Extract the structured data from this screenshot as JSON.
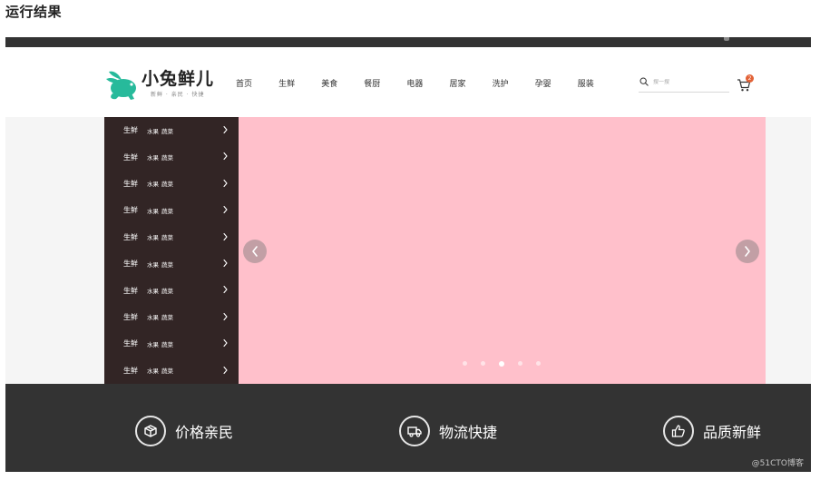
{
  "article": {
    "heading": "运行结果"
  },
  "header": {
    "logo": {
      "text": "小兔鲜儿",
      "slogan": "新鲜 · 亲民 · 快捷",
      "brand_color": "#27ba9b"
    },
    "nav_items": [
      {
        "label": "首页"
      },
      {
        "label": "生鲜"
      },
      {
        "label": "美食"
      },
      {
        "label": "餐厨"
      },
      {
        "label": "电器"
      },
      {
        "label": "居家"
      },
      {
        "label": "洗护"
      },
      {
        "label": "孕婴"
      },
      {
        "label": "服装"
      }
    ],
    "search": {
      "placeholder": "搜一搜",
      "icon": "search-icon"
    },
    "cart": {
      "icon": "cart-icon",
      "badge": "2",
      "badge_color": "#e26237"
    }
  },
  "banner": {
    "slide_color": "#ffc0cb",
    "categories": [
      {
        "name": "生鲜",
        "sub1": "水果",
        "sub2": "蔬菜"
      },
      {
        "name": "生鲜",
        "sub1": "水果",
        "sub2": "蔬菜"
      },
      {
        "name": "生鲜",
        "sub1": "水果",
        "sub2": "蔬菜"
      },
      {
        "name": "生鲜",
        "sub1": "水果",
        "sub2": "蔬菜"
      },
      {
        "name": "生鲜",
        "sub1": "水果",
        "sub2": "蔬菜"
      },
      {
        "name": "生鲜",
        "sub1": "水果",
        "sub2": "蔬菜"
      },
      {
        "name": "生鲜",
        "sub1": "水果",
        "sub2": "蔬菜"
      },
      {
        "name": "生鲜",
        "sub1": "水果",
        "sub2": "蔬菜"
      },
      {
        "name": "生鲜",
        "sub1": "水果",
        "sub2": "蔬菜"
      },
      {
        "name": "生鲜",
        "sub1": "水果",
        "sub2": "蔬菜"
      }
    ],
    "dots_count": 5,
    "active_dot": 3
  },
  "services": [
    {
      "label": "价格亲民",
      "icon": "price-box-icon"
    },
    {
      "label": "物流快捷",
      "icon": "delivery-truck-icon"
    },
    {
      "label": "品质新鲜",
      "icon": "thumbs-up-icon"
    }
  ],
  "watermark": "@51CTO博客"
}
